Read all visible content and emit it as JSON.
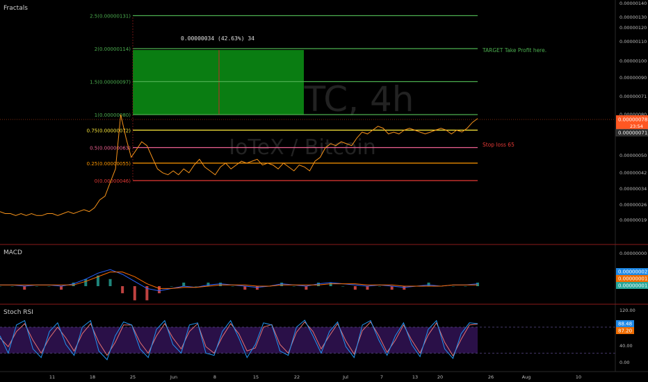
{
  "panels": {
    "main_title": "Fractals",
    "macd_title": "MACD",
    "rsi_title": "Stoch RSI"
  },
  "watermark": {
    "symbol": "IOTXBTC, 4h",
    "pair": "IoTeX / Bitcoin"
  },
  "colors": {
    "background": "#000000",
    "price_line": "#f7931a",
    "fib_green": "#4caf50",
    "fib_yellow": "#ffeb3b",
    "fib_orange": "#ff9800",
    "fib_pink": "#f06292",
    "fib_red": "#e53935",
    "panel_separator": "#8b1a1a",
    "target_box": "#0a7d12",
    "macd_line": "#2962ff",
    "signal_line": "#ff6d00",
    "rsi_band": "#2a1048",
    "rsi_k": "#2196f3",
    "rsi_d": "#e57373",
    "last_price_tag": "#ff5722"
  },
  "annotations": {
    "measure_text": "0.00000034 (42.63%) 34",
    "target_text": "TARGET Take Profit here.",
    "stop_text": "Stop loss 65"
  },
  "price_tags": {
    "last_price": "0.00000078",
    "countdown": "23:54",
    "second_price": "0.00000071",
    "hidden_level": "0.00000080"
  },
  "macd_tags": [
    "0.00000002",
    "0.00000001",
    "0.00000001"
  ],
  "rsi_tags": [
    "88.48",
    "87.20"
  ],
  "chart_data": [
    {
      "type": "line",
      "panel": "price",
      "y_axis_ticks": [
        "0.00000140",
        "0.00000130",
        "0.00000120",
        "0.00000110",
        "0.00000100",
        "0.00000090",
        "0.00000071",
        "0.00000060",
        "0.00000050",
        "0.00000042",
        "0.00000034",
        "0.00000026",
        "0.00000019"
      ],
      "x_axis_ticks": [
        "11",
        "18",
        "25",
        "Jun",
        "8",
        "15",
        "22",
        "Jul",
        "7",
        "13",
        "20",
        "26",
        "Aug",
        "10"
      ],
      "fib_levels": [
        {
          "label": "2.5(0.00000131)",
          "ratio": 2.5,
          "price": 1.31e-06,
          "color": "fib_green"
        },
        {
          "label": "2(0.00000114)",
          "ratio": 2,
          "price": 1.14e-06,
          "color": "fib_green"
        },
        {
          "label": "1.5(0.00000097)",
          "ratio": 1.5,
          "price": 9.7e-07,
          "color": "fib_green"
        },
        {
          "label": "1(0.00000080)",
          "ratio": 1,
          "price": 8e-07,
          "color": "fib_green"
        },
        {
          "label": "0.75(0.00000072)",
          "ratio": 0.75,
          "price": 7.2e-07,
          "color": "fib_yellow"
        },
        {
          "label": "0.5(0.00000063)",
          "ratio": 0.5,
          "price": 6.3e-07,
          "color": "fib_pink"
        },
        {
          "label": "0.25(0.00000055)",
          "ratio": 0.25,
          "price": 5.5e-07,
          "color": "fib_orange"
        },
        {
          "label": "0(0.00000046)",
          "ratio": 0,
          "price": 4.6e-07,
          "color": "fib_red"
        }
      ],
      "series": [
        {
          "values": [
            3e-07,
            2.9e-07,
            2.9e-07,
            2.8e-07,
            2.9e-07,
            2.8e-07,
            2.9e-07,
            2.8e-07,
            2.8e-07,
            2.9e-07,
            2.9e-07,
            2.8e-07,
            2.9e-07,
            3e-07,
            2.9e-07,
            3e-07,
            3.1e-07,
            3e-07,
            3.2e-07,
            3.6e-07,
            3.8e-07,
            4.5e-07,
            5.2e-07,
            8e-07,
            6.8e-07,
            5.8e-07,
            6.2e-07,
            6.6e-07,
            6.4e-07,
            5.8e-07,
            5.2e-07,
            5e-07,
            4.9e-07,
            5.1e-07,
            4.9e-07,
            5.2e-07,
            5e-07,
            5.4e-07,
            5.7e-07,
            5.3e-07,
            5.1e-07,
            4.9e-07,
            5.3e-07,
            5.5e-07,
            5.2e-07,
            5.4e-07,
            5.6e-07,
            5.5e-07,
            5.6e-07,
            5.7e-07,
            5.4e-07,
            5.5e-07,
            5.4e-07,
            5.2e-07,
            5.5e-07,
            5.3e-07,
            5.1e-07,
            5.4e-07,
            5.3e-07,
            5.1e-07,
            5.6e-07,
            5.8e-07,
            6.3e-07,
            6.5e-07,
            6.4e-07,
            6.6e-07,
            6.5e-07,
            6.4e-07,
            6.8e-07,
            7.1e-07,
            7e-07,
            7.2e-07,
            7.4e-07,
            7.3e-07,
            7e-07,
            7.1e-07,
            7e-07,
            7.2e-07,
            7.3e-07,
            7.2e-07,
            7.1e-07,
            7e-07,
            7.1e-07,
            7.2e-07,
            7.3e-07,
            7.2e-07,
            7e-07,
            7.2e-07,
            7.1e-07,
            7.3e-07,
            7.6e-07,
            7.8e-07
          ]
        }
      ]
    },
    {
      "type": "line",
      "panel": "macd",
      "series": [
        {
          "name": "MACD",
          "values": [
            1e-09,
            1e-09,
            0.0,
            1e-09,
            1e-09,
            0.0,
            2e-09,
            6e-09,
            1.1e-08,
            1.4e-08,
            1e-08,
            4e-09,
            -2e-09,
            -4e-09,
            -2e-09,
            0.0,
            -1e-09,
            1e-09,
            2e-09,
            1e-09,
            0.0,
            -1e-09,
            0.0,
            2e-09,
            1e-09,
            0.0,
            2e-09,
            3e-09,
            2e-09,
            1e-09,
            0.0,
            1e-09,
            0.0,
            -1e-09,
            0.0,
            1e-09,
            0.0,
            1e-09,
            1e-09,
            2e-09
          ]
        },
        {
          "name": "Signal",
          "values": [
            1e-09,
            1e-09,
            1e-09,
            1e-09,
            1e-09,
            1e-09,
            1e-09,
            4e-09,
            8e-09,
            1.2e-08,
            1.2e-08,
            8e-09,
            2e-09,
            -2e-09,
            -2e-09,
            -1e-09,
            -1e-09,
            0.0,
            1e-09,
            1e-09,
            1e-09,
            0.0,
            0.0,
            1e-09,
            1e-09,
            1e-09,
            1e-09,
            2e-09,
            2e-09,
            2e-09,
            1e-09,
            1e-09,
            1e-09,
            0.0,
            0.0,
            0.0,
            0.0,
            1e-09,
            1e-09,
            1e-09
          ]
        }
      ]
    },
    {
      "type": "line",
      "panel": "stoch_rsi",
      "y_axis_ticks": [
        "120.00",
        "40.00",
        "0.00"
      ],
      "band": [
        20,
        80
      ],
      "series": [
        {
          "name": "K",
          "values": [
            60,
            20,
            85,
            95,
            30,
            10,
            70,
            90,
            40,
            15,
            80,
            95,
            25,
            5,
            60,
            92,
            85,
            30,
            10,
            75,
            95,
            40,
            20,
            85,
            90,
            20,
            15,
            70,
            95,
            55,
            10,
            40,
            90,
            85,
            25,
            15,
            80,
            96,
            60,
            20,
            70,
            92,
            35,
            10,
            85,
            95,
            50,
            15,
            60,
            90,
            40,
            12,
            75,
            95,
            30,
            8,
            65,
            90,
            88
          ]
        },
        {
          "name": "D",
          "values": [
            55,
            35,
            70,
            88,
            50,
            20,
            55,
            80,
            55,
            25,
            65,
            88,
            45,
            15,
            45,
            85,
            85,
            45,
            20,
            60,
            88,
            55,
            30,
            70,
            88,
            35,
            20,
            58,
            88,
            65,
            25,
            32,
            80,
            86,
            40,
            20,
            68,
            92,
            70,
            30,
            60,
            88,
            48,
            18,
            72,
            92,
            60,
            22,
            50,
            85,
            50,
            20,
            62,
            90,
            45,
            14,
            52,
            85,
            87
          ]
        }
      ]
    }
  ]
}
